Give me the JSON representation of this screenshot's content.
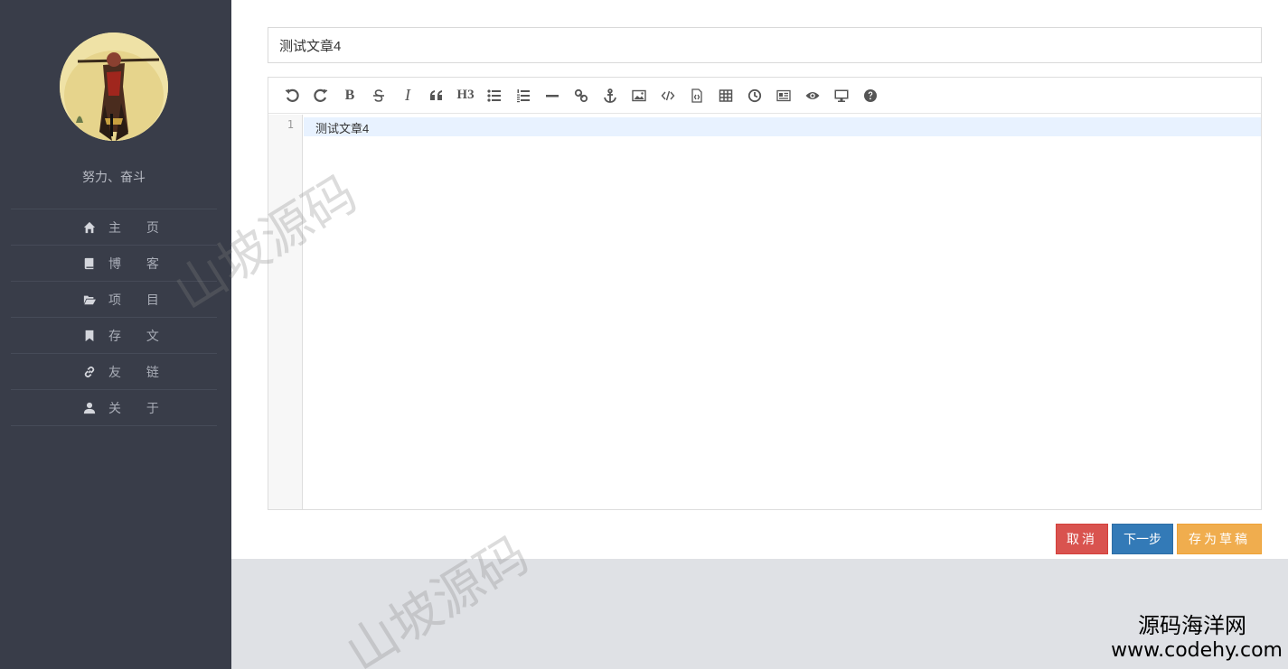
{
  "sidebar": {
    "motto": "努力、奋斗",
    "nav": [
      {
        "label": "主 页",
        "icon": "home-icon"
      },
      {
        "label": "博 客",
        "icon": "book-icon"
      },
      {
        "label": "项 目",
        "icon": "folder-open-icon"
      },
      {
        "label": "存 文",
        "icon": "bookmark-icon"
      },
      {
        "label": "友 链",
        "icon": "link-icon"
      },
      {
        "label": "关 于",
        "icon": "user-icon"
      }
    ]
  },
  "editor": {
    "title_value": "测试文章4",
    "toolbar": {
      "bold": "B",
      "italic": "I",
      "heading": "H3"
    },
    "line_number": "1",
    "content": "测试文章4"
  },
  "actions": {
    "cancel": "取消",
    "next": "下一步",
    "draft": "存为草稿"
  },
  "watermark": "山坡源码",
  "brand": {
    "cn": "源码海洋网",
    "url": "www.codehy.com"
  },
  "colors": {
    "sidebar_bg": "#393d49",
    "cancel": "#d9534f",
    "next": "#337ab7",
    "draft": "#f0ad4e"
  }
}
